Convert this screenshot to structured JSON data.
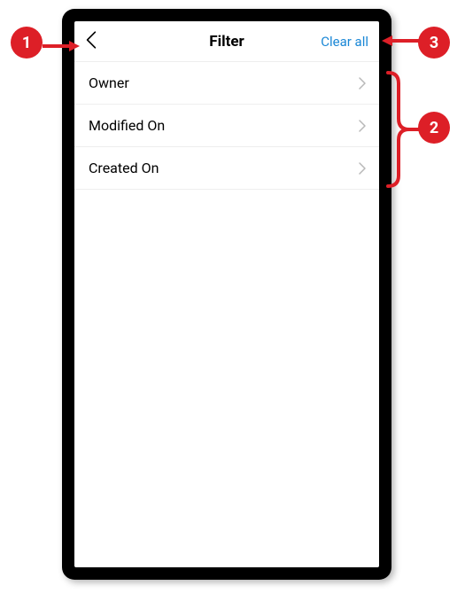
{
  "header": {
    "title": "Filter",
    "clear_all_label": "Clear all"
  },
  "filters": [
    {
      "label": "Owner"
    },
    {
      "label": "Modified On"
    },
    {
      "label": "Created On"
    }
  ],
  "annotations": {
    "a1": "1",
    "a2": "2",
    "a3": "3"
  },
  "colors": {
    "accent": "#1a87d6",
    "callout": "#dd1f27"
  }
}
